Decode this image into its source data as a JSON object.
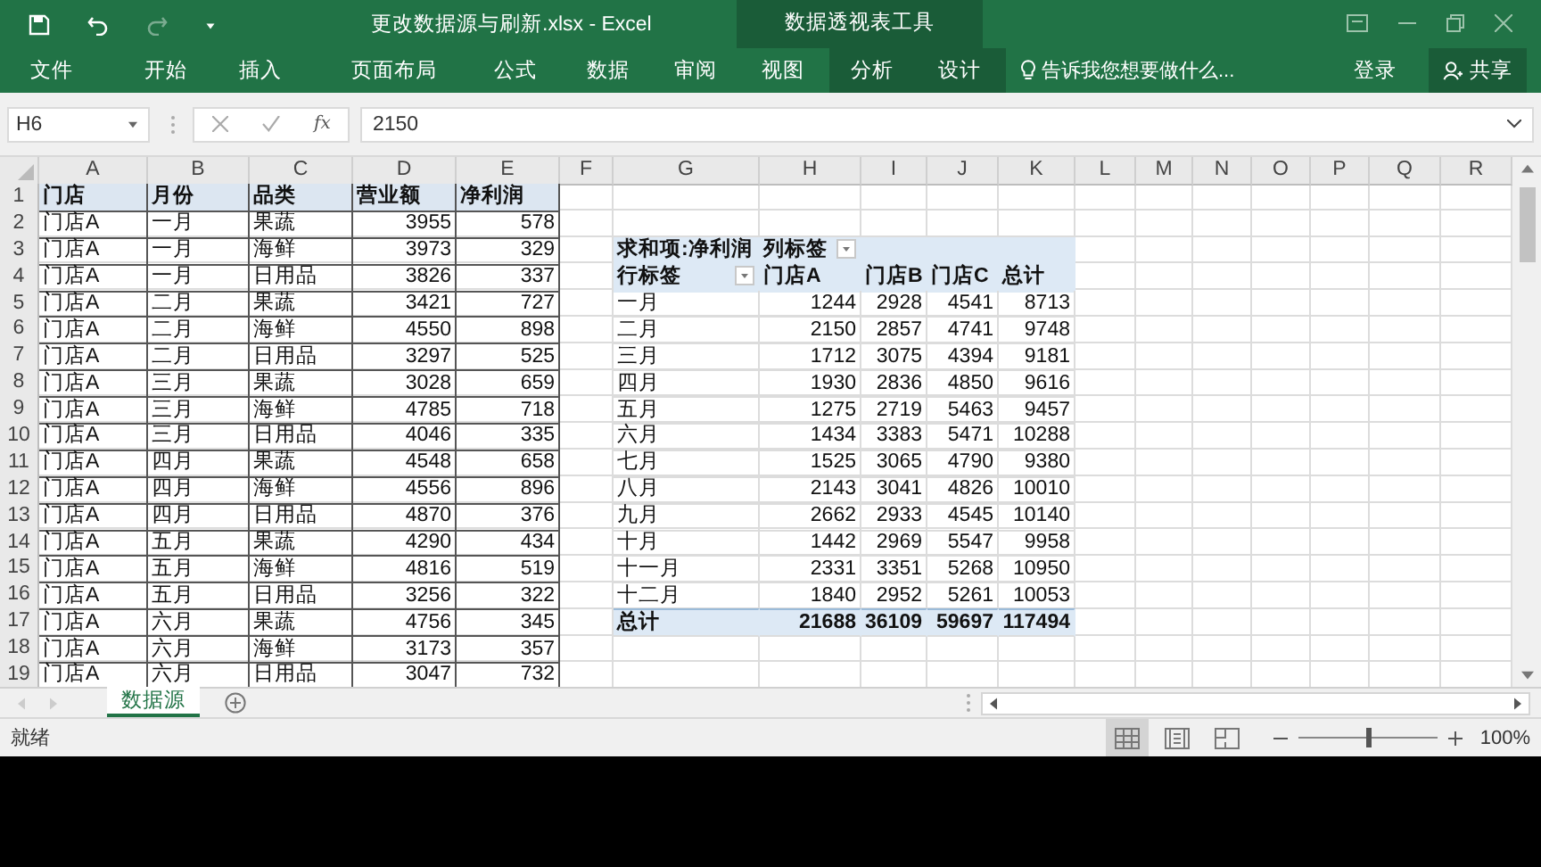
{
  "title_bar": {
    "file_title": "更改数据源与刷新.xlsx - Excel",
    "context_title": "数据透视表工具"
  },
  "ribbon_tabs": [
    {
      "label": "文件",
      "contextual": false
    },
    {
      "label": "开始",
      "contextual": false
    },
    {
      "label": "插入",
      "contextual": false
    },
    {
      "label": "页面布局",
      "contextual": false
    },
    {
      "label": "公式",
      "contextual": false
    },
    {
      "label": "数据",
      "contextual": false
    },
    {
      "label": "审阅",
      "contextual": false
    },
    {
      "label": "视图",
      "contextual": false
    },
    {
      "label": "分析",
      "contextual": true
    },
    {
      "label": "设计",
      "contextual": true
    }
  ],
  "tell_me": {
    "placeholder": "告诉我您想要做什么..."
  },
  "sign_in": "登录",
  "share": "共享",
  "formula_bar": {
    "name_box": "H6",
    "function_label": "fx",
    "value": "2150"
  },
  "columns": [
    "A",
    "B",
    "C",
    "D",
    "E",
    "F",
    "G",
    "H",
    "I",
    "J",
    "K",
    "L",
    "M",
    "N",
    "O",
    "P",
    "Q",
    "R"
  ],
  "rows": [
    {
      "number": "1",
      "kind": "header",
      "cells": [
        "门店",
        "月份",
        "品类",
        "营业额",
        "净利润"
      ]
    },
    {
      "number": "2",
      "kind": "data",
      "cells": [
        "门店A",
        "一月",
        "果蔬",
        "3955",
        "578"
      ]
    },
    {
      "number": "3",
      "kind": "data",
      "cells": [
        "门店A",
        "一月",
        "海鲜",
        "3973",
        "329"
      ]
    },
    {
      "number": "4",
      "kind": "data",
      "cells": [
        "门店A",
        "一月",
        "日用品",
        "3826",
        "337"
      ]
    },
    {
      "number": "5",
      "kind": "data",
      "cells": [
        "门店A",
        "二月",
        "果蔬",
        "3421",
        "727"
      ]
    },
    {
      "number": "6",
      "kind": "data",
      "cells": [
        "门店A",
        "二月",
        "海鲜",
        "4550",
        "898"
      ]
    },
    {
      "number": "7",
      "kind": "data",
      "cells": [
        "门店A",
        "二月",
        "日用品",
        "3297",
        "525"
      ]
    },
    {
      "number": "8",
      "kind": "data",
      "cells": [
        "门店A",
        "三月",
        "果蔬",
        "3028",
        "659"
      ]
    },
    {
      "number": "9",
      "kind": "data",
      "cells": [
        "门店A",
        "三月",
        "海鲜",
        "4785",
        "718"
      ]
    },
    {
      "number": "10",
      "kind": "data",
      "cells": [
        "门店A",
        "三月",
        "日用品",
        "4046",
        "335"
      ]
    },
    {
      "number": "11",
      "kind": "data",
      "cells": [
        "门店A",
        "四月",
        "果蔬",
        "4548",
        "658"
      ]
    },
    {
      "number": "12",
      "kind": "data",
      "cells": [
        "门店A",
        "四月",
        "海鲜",
        "4556",
        "896"
      ]
    },
    {
      "number": "13",
      "kind": "data",
      "cells": [
        "门店A",
        "四月",
        "日用品",
        "4870",
        "376"
      ]
    },
    {
      "number": "14",
      "kind": "data",
      "cells": [
        "门店A",
        "五月",
        "果蔬",
        "4290",
        "434"
      ]
    },
    {
      "number": "15",
      "kind": "data",
      "cells": [
        "门店A",
        "五月",
        "海鲜",
        "4816",
        "519"
      ]
    },
    {
      "number": "16",
      "kind": "data",
      "cells": [
        "门店A",
        "五月",
        "日用品",
        "3256",
        "322"
      ]
    },
    {
      "number": "17",
      "kind": "data",
      "cells": [
        "门店A",
        "六月",
        "果蔬",
        "4756",
        "345"
      ]
    },
    {
      "number": "18",
      "kind": "data",
      "cells": [
        "门店A",
        "六月",
        "海鲜",
        "3173",
        "357"
      ]
    },
    {
      "number": "19",
      "kind": "data",
      "cells": [
        "门店A",
        "六月",
        "日用品",
        "3047",
        "732"
      ]
    }
  ],
  "pivot": {
    "title": "求和项:净利润",
    "column_label": "列标签",
    "row_label": "行标签",
    "headers": [
      "门店A",
      "门店B",
      "门店C",
      "总计"
    ],
    "rows": [
      {
        "label": "一月",
        "values": [
          "1244",
          "2928",
          "4541",
          "8713"
        ]
      },
      {
        "label": "二月",
        "values": [
          "2150",
          "2857",
          "4741",
          "9748"
        ]
      },
      {
        "label": "三月",
        "values": [
          "1712",
          "3075",
          "4394",
          "9181"
        ]
      },
      {
        "label": "四月",
        "values": [
          "1930",
          "2836",
          "4850",
          "9616"
        ]
      },
      {
        "label": "五月",
        "values": [
          "1275",
          "2719",
          "5463",
          "9457"
        ]
      },
      {
        "label": "六月",
        "values": [
          "1434",
          "3383",
          "5471",
          "10288"
        ]
      },
      {
        "label": "七月",
        "values": [
          "1525",
          "3065",
          "4790",
          "9380"
        ]
      },
      {
        "label": "八月",
        "values": [
          "2143",
          "3041",
          "4826",
          "10010"
        ]
      },
      {
        "label": "九月",
        "values": [
          "2662",
          "2933",
          "4545",
          "10140"
        ]
      },
      {
        "label": "十月",
        "values": [
          "1442",
          "2969",
          "5547",
          "9958"
        ]
      },
      {
        "label": "十一月",
        "values": [
          "2331",
          "3351",
          "5268",
          "10950"
        ]
      },
      {
        "label": "十二月",
        "values": [
          "1840",
          "2952",
          "5261",
          "10053"
        ]
      }
    ],
    "total": {
      "label": "总计",
      "values": [
        "21688",
        "36109",
        "59697",
        "117494"
      ]
    }
  },
  "sheet_tabs": [
    {
      "label": "数据源",
      "selected": true
    }
  ],
  "status": "就绪",
  "views": [
    {
      "kind": "normal",
      "selected": true
    },
    {
      "kind": "page_layout",
      "selected": false
    },
    {
      "kind": "page_break",
      "selected": false
    }
  ],
  "zoom": {
    "level": 0.5,
    "reading": "100%"
  }
}
